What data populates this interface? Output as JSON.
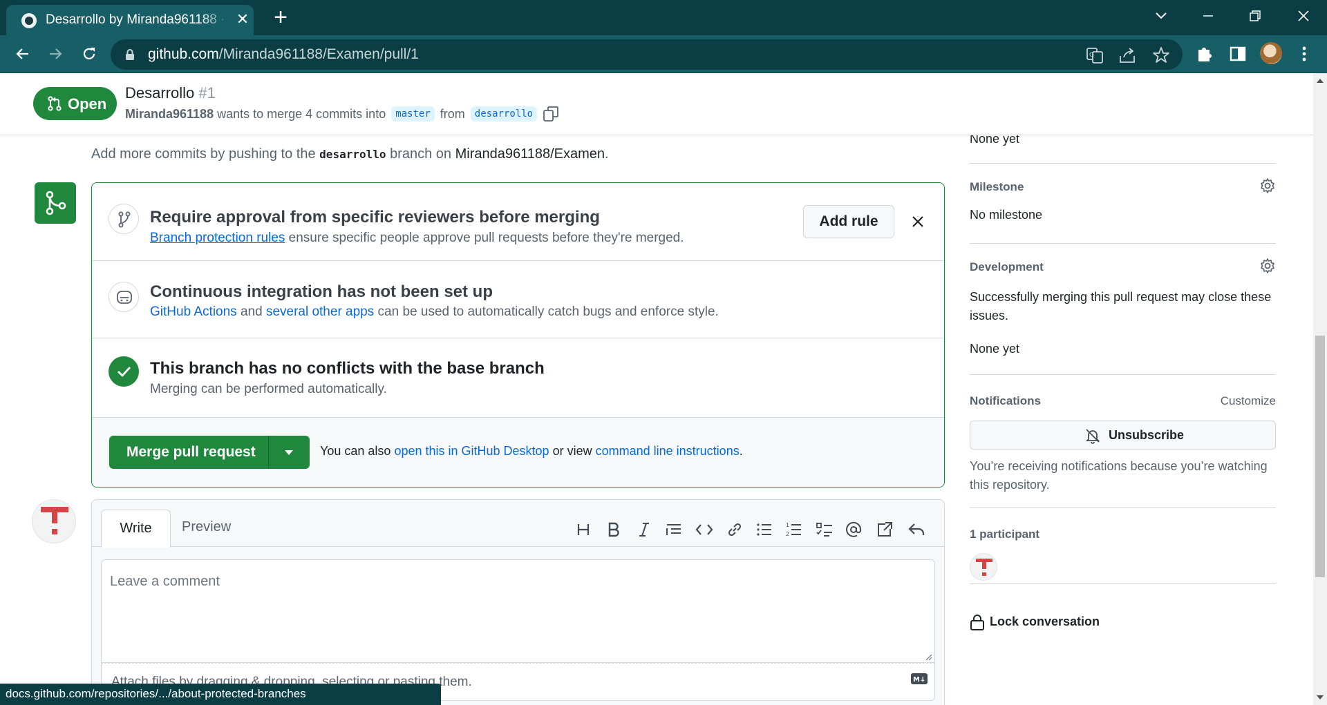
{
  "browser": {
    "tab_title": "Desarrollo by Miranda961188 · Pull Request #1 · Miranda961188/Examen",
    "url_host": "github.com",
    "url_path": "/Miranda961188/Examen/pull/1",
    "status_url": "docs.github.com/repositories/.../about-protected-branches"
  },
  "header": {
    "state_label": "Open",
    "title": "Desarrollo",
    "number": "#1",
    "author": "Miranda961188",
    "merge_text": "wants to merge 4 commits into",
    "base_branch": "master",
    "from_text": "from",
    "head_branch": "desarrollo"
  },
  "timeline": {
    "push_prefix": "Add more commits by pushing to the",
    "push_branch": "desarrollo",
    "push_middle": "branch on",
    "push_repo": "Miranda961188/Examen",
    "push_suffix": "."
  },
  "merge_box": {
    "protect_title": "Require approval from specific reviewers before merging",
    "protect_link": "Branch protection rules",
    "protect_text": "ensure specific people approve pull requests before they're merged.",
    "add_rule_label": "Add rule",
    "ci_title": "Continuous integration has not been set up",
    "ci_link1": "GitHub Actions",
    "ci_and": "and",
    "ci_link2": "several other apps",
    "ci_text": "can be used to automatically catch bugs and enforce style.",
    "conflict_title": "This branch has no conflicts with the base branch",
    "conflict_text": "Merging can be performed automatically.",
    "merge_button": "Merge pull request",
    "alt_prefix": "You can also",
    "alt_link1": "open this in GitHub Desktop",
    "alt_middle": "or view",
    "alt_link2": "command line instructions",
    "alt_suffix": "."
  },
  "editor": {
    "tab_write": "Write",
    "tab_preview": "Preview",
    "placeholder": "Leave a comment",
    "attach_text": "Attach files by dragging & dropping, selecting or pasting them.",
    "md_badge": "M↓"
  },
  "sidebar": {
    "partial_text": "None yet",
    "milestone_heading": "Milestone",
    "milestone_value": "No milestone",
    "development_heading": "Development",
    "development_text": "Successfully merging this pull request may close these issues.",
    "development_value": "None yet",
    "notifications_heading": "Notifications",
    "customize_label": "Customize",
    "unsubscribe_label": "Unsubscribe",
    "notify_reason": "You’re receiving notifications because you’re watching this repository.",
    "participants_heading": "1 participant",
    "lock_label": "Lock conversation"
  },
  "colors": {
    "accent_green": "#1f883d",
    "link_blue": "#0969da",
    "chrome_dark": "#0a3d44",
    "chrome_toolbar": "#175e66"
  }
}
